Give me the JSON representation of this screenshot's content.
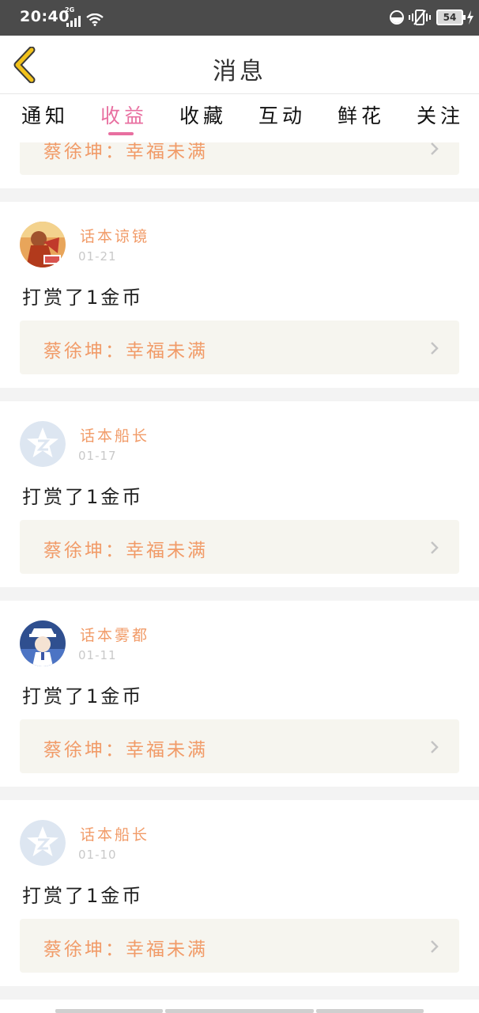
{
  "status_bar": {
    "time": "20:40",
    "network_type": "2G",
    "battery": "54",
    "icons": [
      "signal-icon",
      "wifi-icon",
      "do-not-disturb-icon",
      "vibrate-icon",
      "battery-icon",
      "charging-icon"
    ]
  },
  "header": {
    "title": "消息",
    "back_icon": "chevron-left-icon"
  },
  "tabs": [
    {
      "label": "通知",
      "active": false
    },
    {
      "label": "收益",
      "active": true
    },
    {
      "label": "收藏",
      "active": false
    },
    {
      "label": "互动",
      "active": false
    },
    {
      "label": "鲜花",
      "active": false
    },
    {
      "label": "关注",
      "active": false
    }
  ],
  "partial_card": {
    "reference": "蔡徐坤：幸福未满"
  },
  "messages": [
    {
      "username": "话本谅镜",
      "date": "01-21",
      "text": "打赏了1金币",
      "reference": "蔡徐坤：幸福未满",
      "avatar": "book-cover-avatar"
    },
    {
      "username": "话本船长",
      "date": "01-17",
      "text": "打赏了1金币",
      "reference": "蔡徐坤：幸福未满",
      "avatar": "default-avatar"
    },
    {
      "username": "话本雾都",
      "date": "01-11",
      "text": "打赏了1金币",
      "reference": "蔡徐坤：幸福未满",
      "avatar": "anime-avatar"
    },
    {
      "username": "话本船长",
      "date": "01-10",
      "text": "打赏了1金币",
      "reference": "蔡徐坤：幸福未满",
      "avatar": "default-avatar"
    }
  ],
  "colors": {
    "accent": "#e86fa0",
    "username": "#f19b68",
    "back_icon": "#f2c21b",
    "ref_background": "#f6f5ef",
    "status_bar": "#4b4b4b"
  }
}
